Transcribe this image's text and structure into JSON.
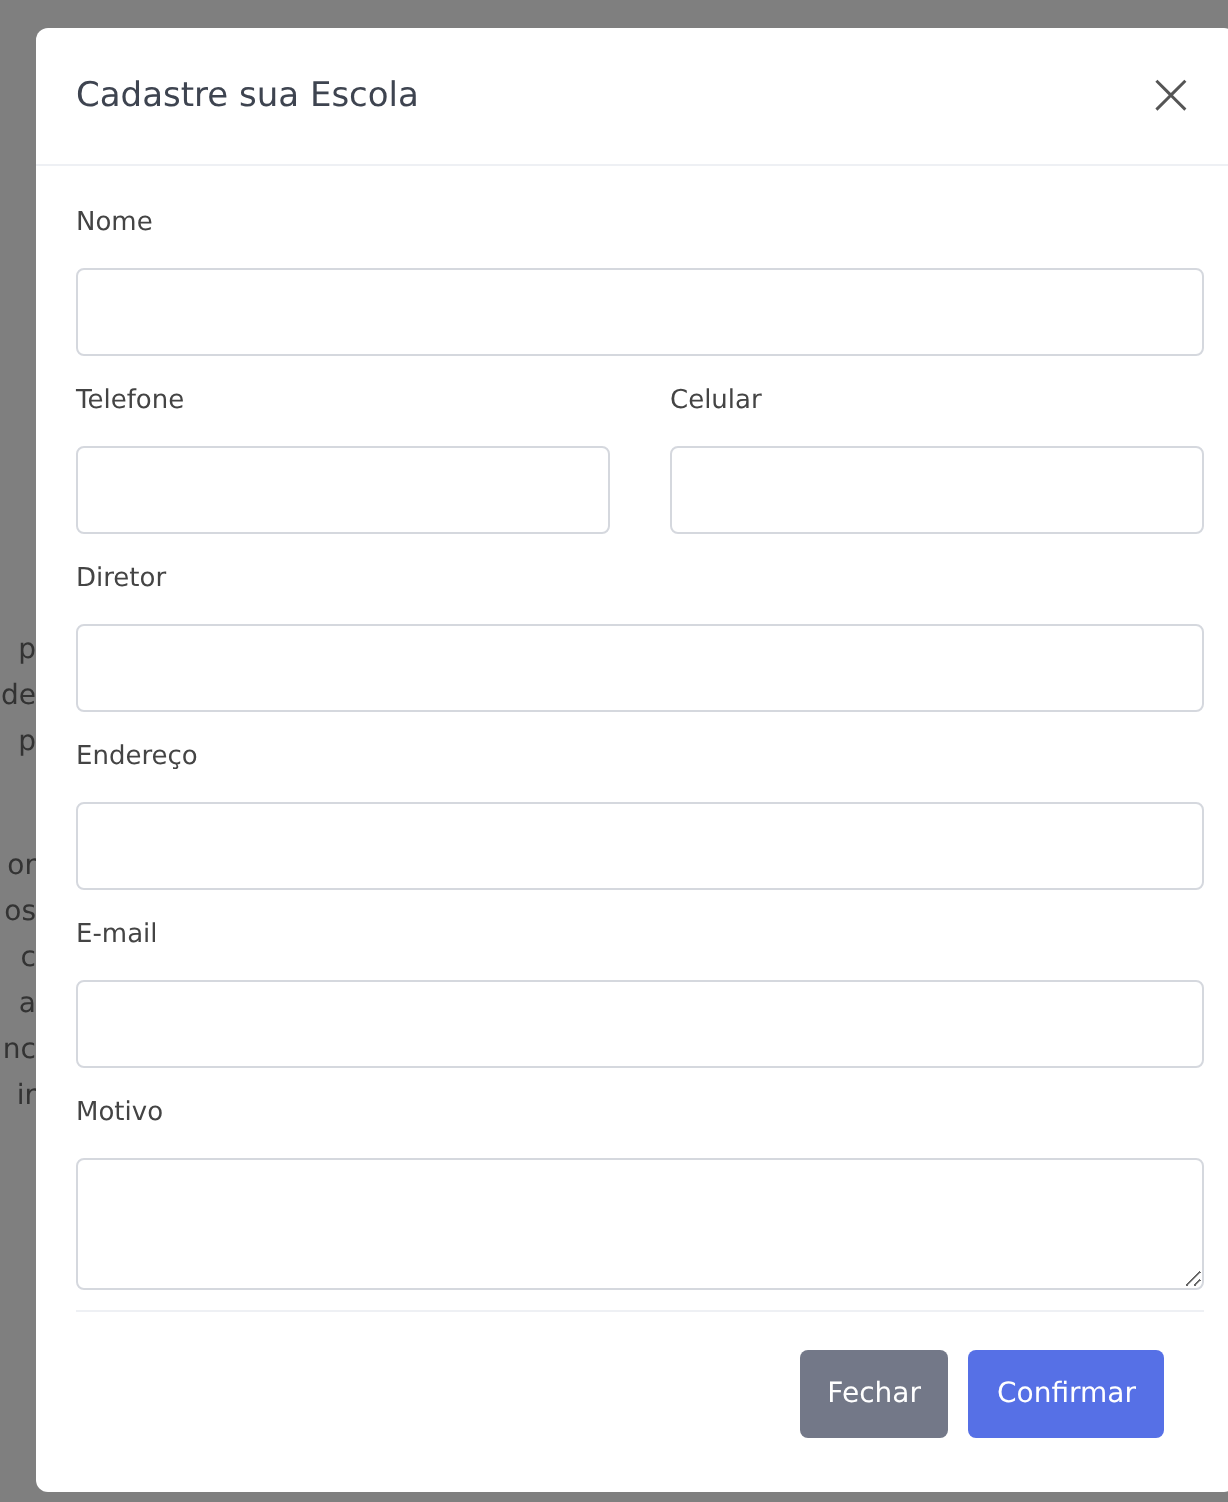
{
  "background_fragments": [
    [
      "p",
      "de",
      "p"
    ],
    [
      "or",
      "os",
      "c",
      "a",
      "nc",
      "ir"
    ]
  ],
  "modal": {
    "title": "Cadastre sua Escola",
    "close": "×",
    "field_rows": [
      [
        {
          "label": "Nome",
          "kind": "text"
        }
      ],
      [
        {
          "label": "Telefone",
          "kind": "text"
        },
        {
          "label": "Celular",
          "kind": "text"
        }
      ],
      [
        {
          "label": "Diretor",
          "kind": "text"
        }
      ],
      [
        {
          "label": "Endereço",
          "kind": "text"
        }
      ],
      [
        {
          "label": "E-mail",
          "kind": "text"
        }
      ],
      [
        {
          "label": "Motivo",
          "kind": "textarea"
        }
      ]
    ],
    "buttons": [
      {
        "label": "Fechar",
        "kind": "secondary"
      },
      {
        "label": "Confirmar",
        "kind": "primary"
      }
    ]
  }
}
